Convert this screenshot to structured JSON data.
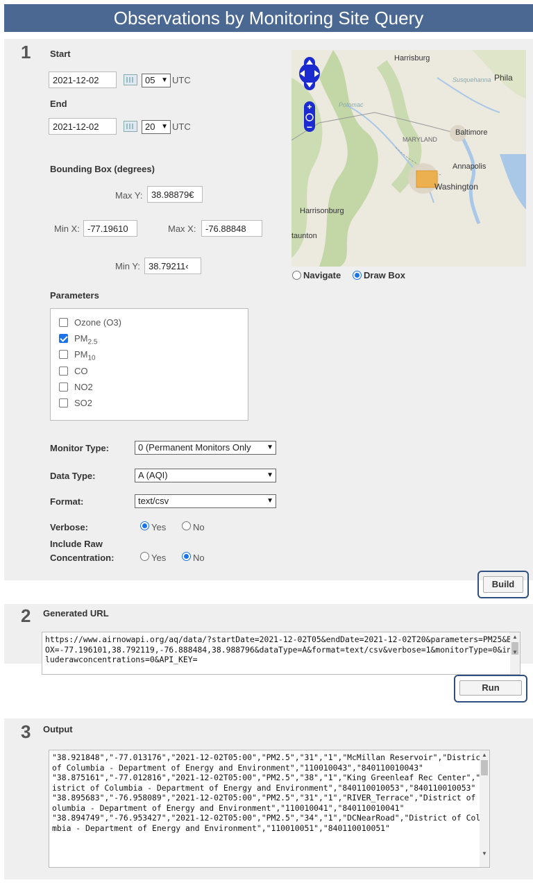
{
  "header": {
    "title": "Observations by Monitoring Site Query"
  },
  "section1": {
    "step": "1",
    "start_label": "Start",
    "start_date": "2021-12-02",
    "start_hour": "05",
    "utc1": "UTC",
    "end_label": "End",
    "end_date": "2021-12-02",
    "end_hour": "20",
    "utc2": "UTC",
    "bbox_label": "Bounding Box (degrees)",
    "maxy_label": "Max Y:",
    "maxy_value": "38.98879€",
    "minx_label": "Min X:",
    "minx_value": "-77.19610",
    "maxx_label": "Max X:",
    "maxx_value": "-76.88848",
    "miny_label": "Min Y:",
    "miny_value": "38.79211‹",
    "map": {
      "labels": [
        "Harrisburg",
        "Phila",
        "Baltimore",
        "MARYLAND",
        "Annapolis",
        "Washington",
        "Harrisonburg",
        "taunton",
        "Potomac",
        "Susquehanna"
      ],
      "water_color": "#a9c7e6",
      "land_color": "#e9e7de",
      "forest_color": "#c5d9a8",
      "box_color": "#f0a830"
    },
    "navigate_label": "Navigate",
    "drawbox_label": "Draw Box",
    "map_mode": "Draw Box",
    "params_label": "Parameters",
    "params": [
      {
        "label": "Ozone (O3)",
        "checked": false
      },
      {
        "label": "PM",
        "sub": "2.5",
        "checked": true
      },
      {
        "label": "PM",
        "sub": "10",
        "checked": false
      },
      {
        "label": "CO",
        "checked": false
      },
      {
        "label": "NO2",
        "checked": false
      },
      {
        "label": "SO2",
        "checked": false
      }
    ],
    "monitor_type_label": "Monitor Type:",
    "monitor_type_value": "0 (Permanent Monitors Only",
    "data_type_label": "Data Type:",
    "data_type_value": "A (AQI)",
    "format_label": "Format:",
    "format_value": "text/csv",
    "verbose_label": "Verbose:",
    "yes": "Yes",
    "no": "No",
    "verbose_value": "Yes",
    "raw_label_1": "Include Raw",
    "raw_label_2": "Concentration:",
    "raw_value": "No",
    "build_label": "Build"
  },
  "section2": {
    "step": "2",
    "title": "Generated URL",
    "url": "https://www.airnowapi.org/aq/data/?startDate=2021-12-02T05&endDate=2021-12-02T20&parameters=PM25&BBOX=-77.196101,38.792119,-76.888484,38.988796&dataType=A&format=text/csv&verbose=1&monitorType=0&includerawconcentrations=0&API_KEY=",
    "run_label": "Run"
  },
  "section3": {
    "step": "3",
    "title": "Output",
    "output": "\"38.921848\",\"-77.013176\",\"2021-12-02T05:00\",\"PM2.5\",\"31\",\"1\",\"McMillan Reservoir\",\"District of Columbia - Department of Energy and Environment\",\"110010043\",\"840110010043\"\n\"38.875161\",\"-77.012816\",\"2021-12-02T05:00\",\"PM2.5\",\"38\",\"1\",\"King Greenleaf Rec Center\",\"District of Columbia - Department of Energy and Environment\",\"840110010053\",\"840110010053\"\n\"38.895683\",\"-76.958089\",\"2021-12-02T05:00\",\"PM2.5\",\"31\",\"1\",\"RIVER_Terrace\",\"District of Columbia - Department of Energy and Environment\",\"110010041\",\"840110010041\"\n\"38.894749\",\"-76.953427\",\"2021-12-02T05:00\",\"PM2.5\",\"34\",\"1\",\"DCNearRoad\",\"District of Columbia - Department of Energy and Environment\",\"110010051\",\"840110010051\""
  },
  "colors": {
    "header_bg": "#4a6891",
    "panel_bg": "#efefef",
    "highlight_border": "#2f4f80",
    "accent": "#1a73e8"
  }
}
